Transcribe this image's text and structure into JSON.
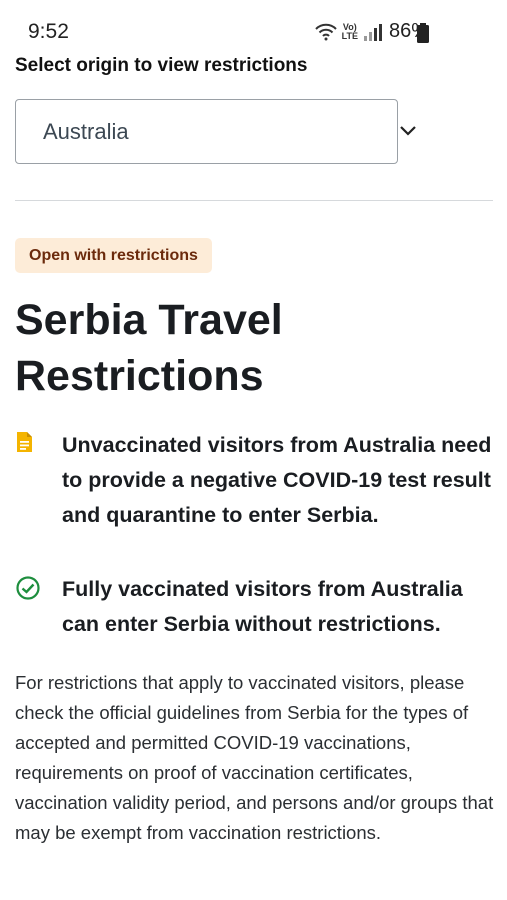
{
  "status_bar": {
    "time": "9:52",
    "lte_top": "Vo)",
    "lte_bottom": "LTE",
    "battery": "86%",
    "icons": [
      "wifi-icon",
      "volte-icon",
      "signal-icon",
      "battery-icon"
    ]
  },
  "origin": {
    "label": "Select origin to view restrictions",
    "selected": "Australia",
    "dropdown_icon": "chevron-down-icon"
  },
  "status_badge": "Open with restrictions",
  "title": "Serbia Travel Restrictions",
  "rules": [
    {
      "icon": "document-icon",
      "text": "Unvaccinated visitors from Australia need to provide a negative COVID-19 test result and quarantine to enter Serbia."
    },
    {
      "icon": "check-circle-icon",
      "text": "Fully vaccinated visitors from Australia can enter Serbia without restrictions."
    }
  ],
  "info": "For restrictions that apply to vaccinated visitors, please check the official guidelines from Serbia for the types of accepted and permitted COVID-19 vaccinations, requirements on proof of vaccination certificates, vaccination validity period, and persons and/or groups that may be exempt from vaccination restrictions.",
  "colors": {
    "badge_bg": "#fdecd8",
    "badge_text": "#6b2a0c",
    "document_icon": "#f4b400",
    "check_icon": "#1e8e3e"
  }
}
